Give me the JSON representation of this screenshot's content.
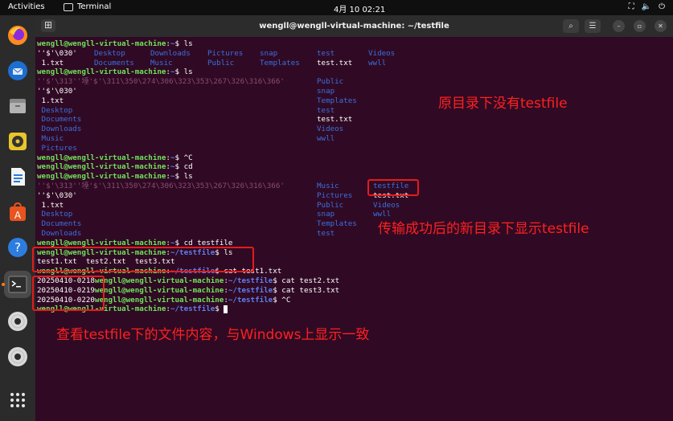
{
  "topbar": {
    "activities": "Activities",
    "app": "Terminal",
    "clock": "4月 10  02:21"
  },
  "dock": {
    "items": [
      "firefox-icon",
      "thunderbird-icon",
      "files-icon",
      "rhythmbox-icon",
      "writer-icon",
      "software-icon",
      "help-icon",
      "terminal-icon",
      "disc-icon",
      "disc-icon",
      "apps-grid-icon"
    ]
  },
  "window": {
    "title": "wengll@wengll-virtual-machine: ~/testfile"
  },
  "terminal": {
    "prompt_user": "wengll@wengll-virtual-machine",
    "home": "~",
    "testfile_dir": "~/testfile",
    "cmd_ls": "$ ls",
    "cmd_ctrlc": "$ ^C",
    "cmd_cd": "$ cd",
    "cmd_cd_testfile": "$ cd testfile",
    "cmd_cat1": "$ cat test1.txt",
    "cmd_cat2": "$ cat test2.txt",
    "cmd_cat3": "$ cat test3.txt",
    "cmd_end": "$ ",
    "row1": [
      "''$'\\030'",
      "Desktop",
      "Downloads",
      "Pictures",
      "snap",
      "test",
      "Videos"
    ],
    "row2": [
      " 1.txt",
      "Documents",
      "Music",
      "Public",
      "Templates",
      "test.txt",
      "wwll"
    ],
    "odd_name": "''$'\\313''㙵'$'\\311\\350\\274\\306\\323\\353\\267\\326\\316\\366'",
    "col_public": "Public",
    "col_snap": "snap",
    "col_templates": "Templates",
    "col_test": "test",
    "col_testtxt": "test.txt",
    "col_videos": "Videos",
    "col_wwll": "wwll",
    "col_pictures": "Pictures",
    "col_music": "Music",
    "col_testfile": "testfile",
    "name_030": "''$'\\030'",
    "name_1txt": " 1.txt",
    "name_desktop": " Desktop",
    "name_documents": " Documents",
    "name_downloads": " Downloads",
    "name_music": " Music",
    "name_pictures": " Pictures",
    "files_list": "test1.txt  test2.txt  test3.txt",
    "cat_out1": "20250410-0218",
    "cat_out2": "20250410-0219",
    "cat_out3": "20250410-0220"
  },
  "annotations": {
    "note1": "原目录下没有testfile",
    "note2": "传输成功后的新目录下显示testfile",
    "note3": "查看testfile下的文件内容，与Windows上显示一致"
  },
  "colors": {
    "terminal_bg": "#300a24",
    "prompt_green": "#6ee35a",
    "path_blue": "#5d7ff0",
    "dir_blue": "#3b6fe0",
    "annotation_red": "#e51b1b"
  }
}
